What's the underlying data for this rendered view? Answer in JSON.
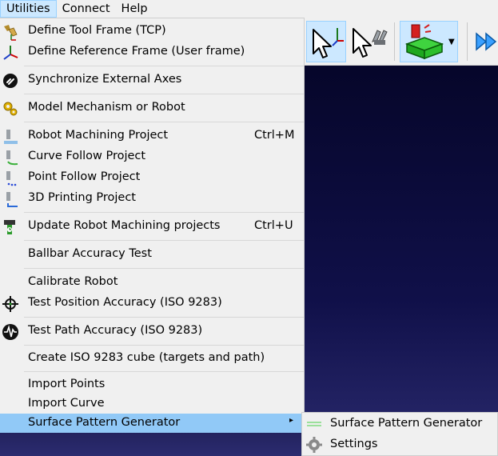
{
  "menubar": {
    "items": [
      {
        "label": "Utilities"
      },
      {
        "label": "Connect"
      },
      {
        "label": "Help"
      }
    ]
  },
  "menu": {
    "items": [
      {
        "label": "Define Tool Frame (TCP)",
        "icon": "tool-frame-icon"
      },
      {
        "label": "Define Reference Frame (User frame)",
        "icon": "reference-frame-icon"
      },
      {
        "label": "Synchronize External Axes",
        "icon": "sync-axes-icon"
      },
      {
        "label": "Model Mechanism or Robot",
        "icon": "gears-icon"
      },
      {
        "label": "Robot Machining Project",
        "icon": "machining-project-icon",
        "shortcut": "Ctrl+M"
      },
      {
        "label": "Curve Follow Project",
        "icon": "curve-follow-icon"
      },
      {
        "label": "Point Follow Project",
        "icon": "point-follow-icon"
      },
      {
        "label": "3D Printing Project",
        "icon": "printing-project-icon"
      },
      {
        "label": "Update Robot Machining projects",
        "icon": "update-machining-icon",
        "shortcut": "Ctrl+U"
      },
      {
        "label": "Ballbar Accuracy Test",
        "icon": ""
      },
      {
        "label": "Calibrate Robot",
        "icon": ""
      },
      {
        "label": "Test Position Accuracy (ISO 9283)",
        "icon": "crosshair-icon"
      },
      {
        "label": "Test Path Accuracy (ISO 9283)",
        "icon": "waveform-icon"
      },
      {
        "label": "Create ISO 9283 cube (targets and path)",
        "icon": ""
      },
      {
        "label": "Import Points",
        "icon": ""
      },
      {
        "label": "Import Curve",
        "icon": ""
      },
      {
        "label": "Surface Pattern Generator",
        "icon": "",
        "submenu_arrow": "▸"
      }
    ]
  },
  "submenu": {
    "items": [
      {
        "label": "Surface Pattern Generator",
        "icon": "surface-pattern-icon"
      },
      {
        "label": "Settings",
        "icon": "settings-gear-icon"
      }
    ]
  },
  "colors": {
    "menu_background": "#f0f0f0",
    "highlight": "#91c9f7",
    "menubar_active": "#cce8ff",
    "viewport_top": "#06062a",
    "viewport_bottom": "#2a2a6e"
  }
}
